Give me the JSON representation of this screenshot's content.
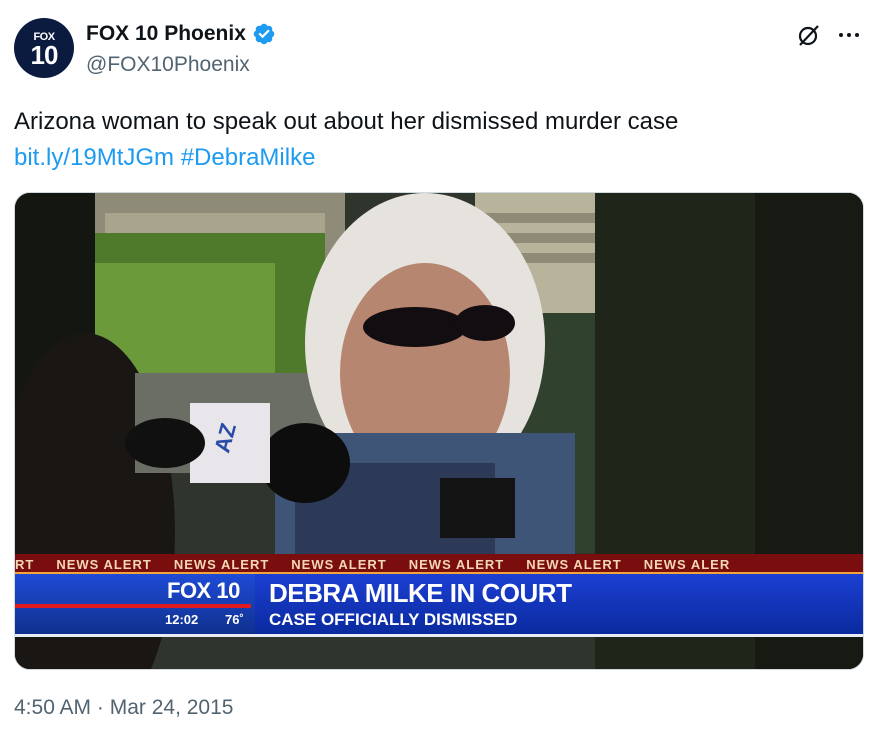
{
  "account": {
    "avatar_line1": "FOX",
    "avatar_line2": "10",
    "name": "FOX 10 Phoenix",
    "handle": "@FOX10Phoenix"
  },
  "tweet": {
    "text": "Arizona woman to speak out about her dismissed murder case",
    "link": "bit.ly/19MtJGm",
    "hashtag": "#DebraMilke",
    "timestamp": "4:50 AM · Mar 24, 2015"
  },
  "broadcast": {
    "ticker_first": "RT",
    "ticker_label": "NEWS ALERT",
    "ticker_last": "NEWS ALER",
    "brand": "FOX 10",
    "time": "12:02",
    "temp": "76˚",
    "headline": "DEBRA MILKE IN COURT",
    "subhead": "CASE OFFICIALLY DISMISSED",
    "mic_flag": "AZ"
  },
  "icons": {
    "verified": "verified-badge-icon",
    "grok": "grok-icon",
    "more": "more-options-icon"
  },
  "colors": {
    "link": "#1d9bf0",
    "verified": "#1d9bf0",
    "lower_third": "#1c3fd3",
    "ticker": "#7a0d0d"
  }
}
